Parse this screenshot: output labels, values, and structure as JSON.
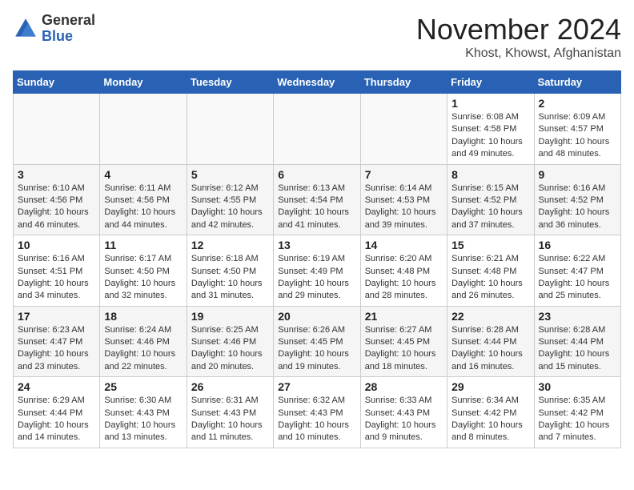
{
  "header": {
    "logo_general": "General",
    "logo_blue": "Blue",
    "month_title": "November 2024",
    "location": "Khost, Khowst, Afghanistan"
  },
  "weekdays": [
    "Sunday",
    "Monday",
    "Tuesday",
    "Wednesday",
    "Thursday",
    "Friday",
    "Saturday"
  ],
  "weeks": [
    [
      {
        "day": "",
        "info": ""
      },
      {
        "day": "",
        "info": ""
      },
      {
        "day": "",
        "info": ""
      },
      {
        "day": "",
        "info": ""
      },
      {
        "day": "",
        "info": ""
      },
      {
        "day": "1",
        "info": "Sunrise: 6:08 AM\nSunset: 4:58 PM\nDaylight: 10 hours\nand 49 minutes."
      },
      {
        "day": "2",
        "info": "Sunrise: 6:09 AM\nSunset: 4:57 PM\nDaylight: 10 hours\nand 48 minutes."
      }
    ],
    [
      {
        "day": "3",
        "info": "Sunrise: 6:10 AM\nSunset: 4:56 PM\nDaylight: 10 hours\nand 46 minutes."
      },
      {
        "day": "4",
        "info": "Sunrise: 6:11 AM\nSunset: 4:56 PM\nDaylight: 10 hours\nand 44 minutes."
      },
      {
        "day": "5",
        "info": "Sunrise: 6:12 AM\nSunset: 4:55 PM\nDaylight: 10 hours\nand 42 minutes."
      },
      {
        "day": "6",
        "info": "Sunrise: 6:13 AM\nSunset: 4:54 PM\nDaylight: 10 hours\nand 41 minutes."
      },
      {
        "day": "7",
        "info": "Sunrise: 6:14 AM\nSunset: 4:53 PM\nDaylight: 10 hours\nand 39 minutes."
      },
      {
        "day": "8",
        "info": "Sunrise: 6:15 AM\nSunset: 4:52 PM\nDaylight: 10 hours\nand 37 minutes."
      },
      {
        "day": "9",
        "info": "Sunrise: 6:16 AM\nSunset: 4:52 PM\nDaylight: 10 hours\nand 36 minutes."
      }
    ],
    [
      {
        "day": "10",
        "info": "Sunrise: 6:16 AM\nSunset: 4:51 PM\nDaylight: 10 hours\nand 34 minutes."
      },
      {
        "day": "11",
        "info": "Sunrise: 6:17 AM\nSunset: 4:50 PM\nDaylight: 10 hours\nand 32 minutes."
      },
      {
        "day": "12",
        "info": "Sunrise: 6:18 AM\nSunset: 4:50 PM\nDaylight: 10 hours\nand 31 minutes."
      },
      {
        "day": "13",
        "info": "Sunrise: 6:19 AM\nSunset: 4:49 PM\nDaylight: 10 hours\nand 29 minutes."
      },
      {
        "day": "14",
        "info": "Sunrise: 6:20 AM\nSunset: 4:48 PM\nDaylight: 10 hours\nand 28 minutes."
      },
      {
        "day": "15",
        "info": "Sunrise: 6:21 AM\nSunset: 4:48 PM\nDaylight: 10 hours\nand 26 minutes."
      },
      {
        "day": "16",
        "info": "Sunrise: 6:22 AM\nSunset: 4:47 PM\nDaylight: 10 hours\nand 25 minutes."
      }
    ],
    [
      {
        "day": "17",
        "info": "Sunrise: 6:23 AM\nSunset: 4:47 PM\nDaylight: 10 hours\nand 23 minutes."
      },
      {
        "day": "18",
        "info": "Sunrise: 6:24 AM\nSunset: 4:46 PM\nDaylight: 10 hours\nand 22 minutes."
      },
      {
        "day": "19",
        "info": "Sunrise: 6:25 AM\nSunset: 4:46 PM\nDaylight: 10 hours\nand 20 minutes."
      },
      {
        "day": "20",
        "info": "Sunrise: 6:26 AM\nSunset: 4:45 PM\nDaylight: 10 hours\nand 19 minutes."
      },
      {
        "day": "21",
        "info": "Sunrise: 6:27 AM\nSunset: 4:45 PM\nDaylight: 10 hours\nand 18 minutes."
      },
      {
        "day": "22",
        "info": "Sunrise: 6:28 AM\nSunset: 4:44 PM\nDaylight: 10 hours\nand 16 minutes."
      },
      {
        "day": "23",
        "info": "Sunrise: 6:28 AM\nSunset: 4:44 PM\nDaylight: 10 hours\nand 15 minutes."
      }
    ],
    [
      {
        "day": "24",
        "info": "Sunrise: 6:29 AM\nSunset: 4:44 PM\nDaylight: 10 hours\nand 14 minutes."
      },
      {
        "day": "25",
        "info": "Sunrise: 6:30 AM\nSunset: 4:43 PM\nDaylight: 10 hours\nand 13 minutes."
      },
      {
        "day": "26",
        "info": "Sunrise: 6:31 AM\nSunset: 4:43 PM\nDaylight: 10 hours\nand 11 minutes."
      },
      {
        "day": "27",
        "info": "Sunrise: 6:32 AM\nSunset: 4:43 PM\nDaylight: 10 hours\nand 10 minutes."
      },
      {
        "day": "28",
        "info": "Sunrise: 6:33 AM\nSunset: 4:43 PM\nDaylight: 10 hours\nand 9 minutes."
      },
      {
        "day": "29",
        "info": "Sunrise: 6:34 AM\nSunset: 4:42 PM\nDaylight: 10 hours\nand 8 minutes."
      },
      {
        "day": "30",
        "info": "Sunrise: 6:35 AM\nSunset: 4:42 PM\nDaylight: 10 hours\nand 7 minutes."
      }
    ]
  ]
}
